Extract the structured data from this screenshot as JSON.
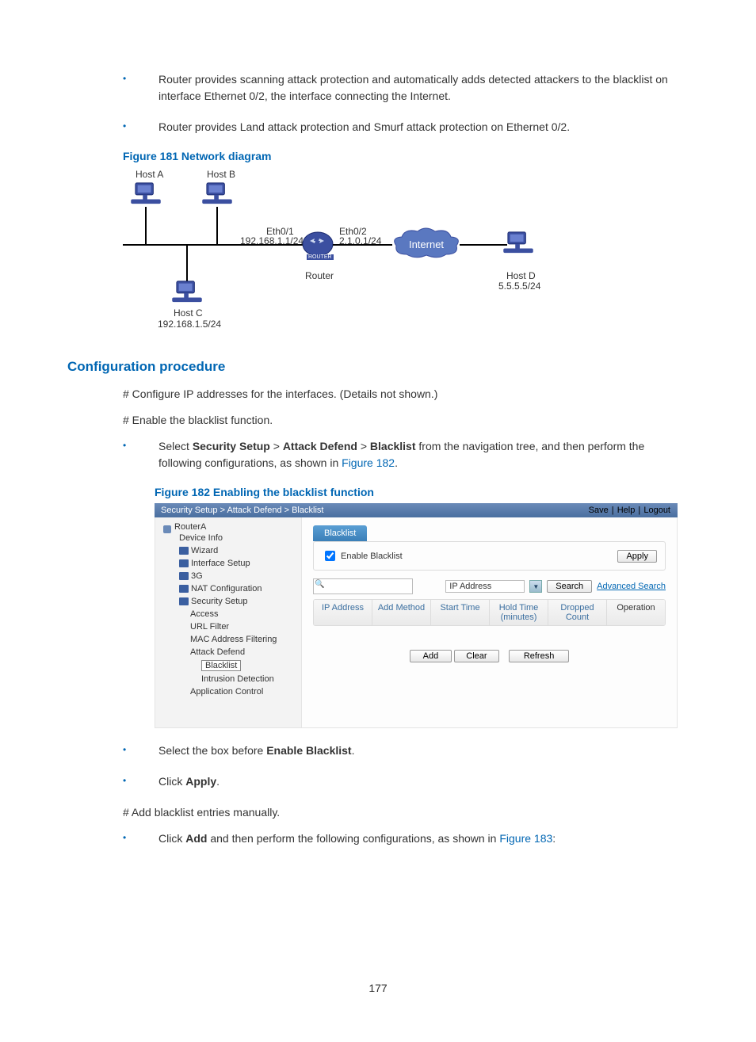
{
  "bullets_top": [
    "Router provides scanning attack protection and automatically adds detected attackers to the blacklist on interface Ethernet 0/2, the interface connecting the Internet.",
    "Router provides Land attack protection and Smurf attack protection on Ethernet 0/2."
  ],
  "figure181_caption": "Figure 181 Network diagram",
  "net": {
    "hostA": "Host A",
    "hostB": "Host B",
    "hostC": "Host C",
    "hostC_ip": "192.168.1.5/24",
    "eth01": "Eth0/1",
    "eth01_ip": "192.168.1.1/24",
    "router": "Router",
    "router_label": "ROUTER",
    "eth02": "Eth0/2",
    "eth02_ip": "2.1.0.1/24",
    "internet": "Internet",
    "hostD": "Host D",
    "hostD_ip": "5.5.5.5/24"
  },
  "h2_config": "Configuration procedure",
  "para1": "# Configure IP addresses for the interfaces. (Details not shown.)",
  "para2": "# Enable the blacklist function.",
  "bullet_select1_pre": "Select ",
  "bullet_select1_b1": "Security Setup",
  "bullet_select1_gt": " > ",
  "bullet_select1_b2": "Attack Defend",
  "bullet_select1_b3": "Blacklist",
  "bullet_select1_post": " from the navigation tree, and then perform the following configurations, as shown in ",
  "bullet_select1_link": "Figure 182",
  "bullet_select1_dot": ".",
  "figure182_caption": "Figure 182 Enabling the blacklist function",
  "ui": {
    "breadcrumb": "Security Setup > Attack Defend > Blacklist",
    "save": "Save",
    "help": "Help",
    "logout": "Logout",
    "root": "RouterA",
    "nav": {
      "device_info": "Device Info",
      "wizard": "Wizard",
      "interface_setup": "Interface Setup",
      "three_g": "3G",
      "nat": "NAT Configuration",
      "security": "Security Setup",
      "access": "Access",
      "url_filter": "URL Filter",
      "mac_filter": "MAC Address Filtering",
      "attack_defend": "Attack Defend",
      "blacklist": "Blacklist",
      "intrusion": "Intrusion Detection",
      "app_control": "Application Control"
    },
    "tab_blacklist": "Blacklist",
    "enable_blacklist": "Enable Blacklist",
    "apply": "Apply",
    "search_field": "IP Address",
    "search_btn": "Search",
    "adv_search": "Advanced Search",
    "cols": {
      "ip": "IP Address",
      "method": "Add Method",
      "start": "Start Time",
      "hold": "Hold Time (minutes)",
      "dropped": "Dropped Count",
      "op": "Operation"
    },
    "add": "Add",
    "clear": "Clear",
    "refresh": "Refresh"
  },
  "bullet_enable_pre": "Select the box before ",
  "bullet_enable_b": "Enable Blacklist",
  "bullet_enable_post": ".",
  "bullet_apply_pre": "Click ",
  "bullet_apply_b": "Apply",
  "bullet_apply_post": ".",
  "para3": "# Add blacklist entries manually.",
  "bullet_add_pre": "Click ",
  "bullet_add_b": "Add",
  "bullet_add_post": " and then perform the following configurations, as shown in ",
  "bullet_add_link": "Figure 183",
  "bullet_add_colon": ":",
  "pagenum": "177"
}
